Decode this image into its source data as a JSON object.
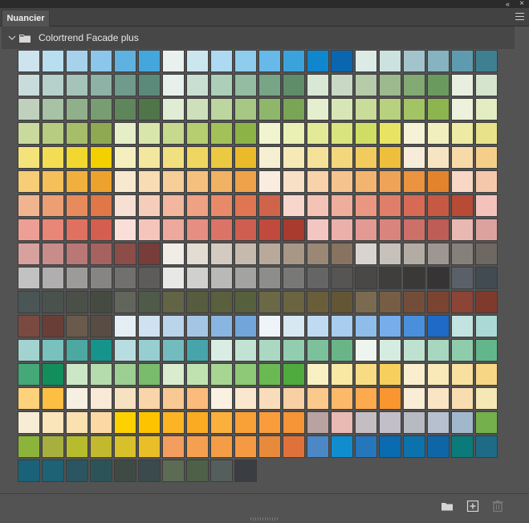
{
  "panel": {
    "tab_label": "Nuancier",
    "collapse_glyph": "«",
    "close_glyph": "×",
    "menu_icon": "hamburger-menu-icon"
  },
  "group": {
    "name": "Colortrend Facade plus",
    "expanded": true,
    "chevron_icon": "chevron-down-icon",
    "folder_icon": "folder-icon"
  },
  "footer": {
    "icons": [
      "new-group-folder-icon",
      "new-swatch-icon",
      "trash-icon"
    ]
  },
  "swatches": [
    [
      "#cde3ee",
      "#b9def0",
      "#a6d2ec",
      "#8cc6ea",
      "#5fb2e0",
      "#45a6de",
      "#e8f1ee",
      "#cce6f0",
      "#aed9f2",
      "#8ecdee",
      "#66b9e8",
      "#3ba3dc",
      "#0f86cd",
      "#0b66b0",
      "#dcebe6",
      "#cbe2de",
      "#a3c4cc",
      "#85b3c0",
      "#5f9bae",
      "#3e7f92"
    ],
    [
      "#c8dcdc",
      "#b6d0cc",
      "#a6c3b9",
      "#8fb2a6",
      "#6f9a8c",
      "#5c8a7a",
      "#e7f0ea",
      "#c9dfd2",
      "#adcfb9",
      "#93bca2",
      "#77a585",
      "#5f8d6a",
      "#d9e7d5",
      "#c9d8c4",
      "#b6cbaa",
      "#9cba8d",
      "#83aa74",
      "#6b9a5e",
      "#e8efe1",
      "#d5e4cc"
    ],
    [
      "#bfd1bd",
      "#a7c2a4",
      "#8fb08a",
      "#789d73",
      "#5f865a",
      "#4f7549",
      "#e1ecd5",
      "#cde0bb",
      "#bcd6a0",
      "#a7c885",
      "#8fb76b",
      "#7aa554",
      "#e5eecf",
      "#d8e6b5",
      "#c9dc9a",
      "#b7d17f",
      "#a2c464",
      "#8cb44f",
      "#eef2dc",
      "#e4ecc2"
    ],
    [
      "#cad99c",
      "#b8cc81",
      "#a6bd6a",
      "#8fa852",
      "#e6eec8",
      "#d8e6ab",
      "#c7d98c",
      "#b6cd70",
      "#a3c159",
      "#8cb346",
      "#f0f4cf",
      "#eaf0b4",
      "#e2ea98",
      "#d9e47e",
      "#cfdd64",
      "#e9e364",
      "#f5f3d6",
      "#f2efbe",
      "#eeeaa4",
      "#e8e38a"
    ],
    [
      "#f3e37a",
      "#f2dd55",
      "#f2d730",
      "#f3d000",
      "#f5eebf",
      "#f3e7a0",
      "#f1e07f",
      "#efd660",
      "#ecc942",
      "#ebba2b",
      "#f7efd1",
      "#f6e9b6",
      "#f5e19a",
      "#f3d77d",
      "#f1cb5d",
      "#eebe3c",
      "#f7ecd9",
      "#f7e4c2",
      "#f7daa7",
      "#f5cf8a"
    ],
    [
      "#f7cd78",
      "#f5bf5a",
      "#f1b03d",
      "#eda22d",
      "#f8e8cf",
      "#f7dcb4",
      "#f6ce98",
      "#f4c07d",
      "#f1b263",
      "#eea24a",
      "#faede0",
      "#f8e0c6",
      "#f7d2aa",
      "#f5c48e",
      "#f2b471",
      "#efa356",
      "#eb933f",
      "#e3842c",
      "#f8d8c4",
      "#f5c8ac"
    ],
    [
      "#f0b48f",
      "#ec9f74",
      "#e78b5c",
      "#df7748",
      "#f8dfd3",
      "#f6cdbb",
      "#f2b79e",
      "#eea183",
      "#e88a69",
      "#e07552",
      "#d0644a",
      "#f7d6cc",
      "#f4c3b5",
      "#efad9c",
      "#e99782",
      "#e07f69",
      "#d66a55",
      "#c55944",
      "#b84b36",
      "#f3c2bb"
    ],
    [
      "#ee9f95",
      "#e88677",
      "#e07161",
      "#d45e4f",
      "#fadfd8",
      "#f5c5bb",
      "#eea99d",
      "#e58e81",
      "#db7467",
      "#cf5e50",
      "#c04a3d",
      "#a83a2e",
      "#f3c6c1",
      "#ecb0aa",
      "#e39a93",
      "#d9857d",
      "#cc7068",
      "#bd5d55",
      "#e8b8b3",
      "#dca39e"
    ],
    [
      "#d7a19e",
      "#c88d8a",
      "#b97875",
      "#a6625e",
      "#8c4c48",
      "#773d3a",
      "#f0ece6",
      "#e3dcd3",
      "#d4cbc0",
      "#c6baae",
      "#b8a99b",
      "#a89786",
      "#9a8775",
      "#877360",
      "#d8d4cf",
      "#c6c1bb",
      "#b3aca5",
      "#9e9690",
      "#85807a",
      "#6e6862"
    ],
    [
      "#c2c2c2",
      "#b0aeae",
      "#9d9b99",
      "#878583",
      "#72706e",
      "#5e5c5b",
      "#e8e8e6",
      "#d0d0ce",
      "#b9b9b8",
      "#a3a3a2",
      "#8d8d8c",
      "#787877",
      "#666565",
      "#565554",
      "#4a4847",
      "#403e3d",
      "#3b3838",
      "#363434",
      "#5b6068",
      "#424a52"
    ],
    [
      "#4a5656",
      "#4a524e",
      "#4a5048",
      "#464b42",
      "#62655b",
      "#4f5a49",
      "#636446",
      "#575c3f",
      "#5a5f3e",
      "#56603c",
      "#6b6845",
      "#6a6440",
      "#695e39",
      "#625635",
      "#7a6a50",
      "#765e45",
      "#724e3a",
      "#7a4430",
      "#8b4436",
      "#7e3b2c"
    ],
    [
      "#7a4a40",
      "#693e37",
      "#6a5a4b",
      "#594c44",
      "#e5eef4",
      "#d0e2f0",
      "#bad4ea",
      "#a4c6e4",
      "#89b6e0",
      "#72a6da",
      "#eef4f8",
      "#d8e8f3",
      "#c0dbf1",
      "#a8cdee",
      "#8fbdea",
      "#76adea",
      "#4a8fdc",
      "#1e6ac6",
      "#c3e3e0",
      "#aad9d6"
    ],
    [
      "#a3d3d1",
      "#79c1bd",
      "#4ba9a2",
      "#16948b",
      "#b8dde0",
      "#97ced0",
      "#72bcc0",
      "#45a5ab",
      "#d9ede4",
      "#c2e3d4",
      "#abd8c3",
      "#93cdb0",
      "#7dc09c",
      "#6ab587",
      "#eef5ee",
      "#d6ece0",
      "#bfe2d0",
      "#a7d7bf",
      "#8fccac",
      "#62b68b"
    ],
    [
      "#44a878",
      "#128d5c",
      "#cbe7c6",
      "#b4dcac",
      "#9ccf92",
      "#78bc6c",
      "#d9ecce",
      "#c0e2b0",
      "#a7d693",
      "#8dc977",
      "#6ab952",
      "#4fab3e",
      "#f9f0c4",
      "#f9e7a4",
      "#f8dc83",
      "#f6cf5c",
      "#f9efcf",
      "#f9e8b8",
      "#f9dfa0",
      "#f7d685"
    ],
    [
      "#fdd27b",
      "#fcbf43",
      "#f6f0e2",
      "#f9ead8",
      "#f6e1c0",
      "#f9d5a9",
      "#f9c994",
      "#fbbb7c",
      "#fbf1e2",
      "#fae7cf",
      "#f9dcbb",
      "#f8d0a4",
      "#fcc98d",
      "#fcb96a",
      "#fcaa4d",
      "#fa962f",
      "#f9edd5",
      "#f9e5c4",
      "#f8ddb1",
      "#f5e8b4"
    ],
    [
      "#f8ecd5",
      "#fae5bb",
      "#fbe0b0",
      "#fcd9a4",
      "#fdd100",
      "#fdc300",
      "#fcb425",
      "#fbab22",
      "#fbb03d",
      "#f9a136",
      "#f99c3c",
      "#f69438",
      "#b8a3a1",
      "#e9b9b4",
      "#c4bdc2",
      "#c3bfc8",
      "#b8bac2",
      "#b7c0cf",
      "#a1b8cc",
      "#74b04c"
    ],
    [
      "#8db43a",
      "#a7b03e",
      "#b6bc2c",
      "#c3b92f",
      "#d8c02a",
      "#e8bf29",
      "#f39e5f",
      "#f5a050",
      "#f39e46",
      "#f59a42",
      "#e78a3c",
      "#e0713b",
      "#4c88c5",
      "#0f8dcf",
      "#2676bc",
      "#0a6bb0",
      "#0d72ac",
      "#0f66a6",
      "#0a7a7a",
      "#1e6b85"
    ],
    [
      "#19627a",
      "#1d6275",
      "#2a5561",
      "#2c5458",
      "#3f4a45",
      "#3a4a4d",
      "#5c6c54",
      "#4e6148",
      "#545f5d",
      "#3a3d42"
    ]
  ]
}
